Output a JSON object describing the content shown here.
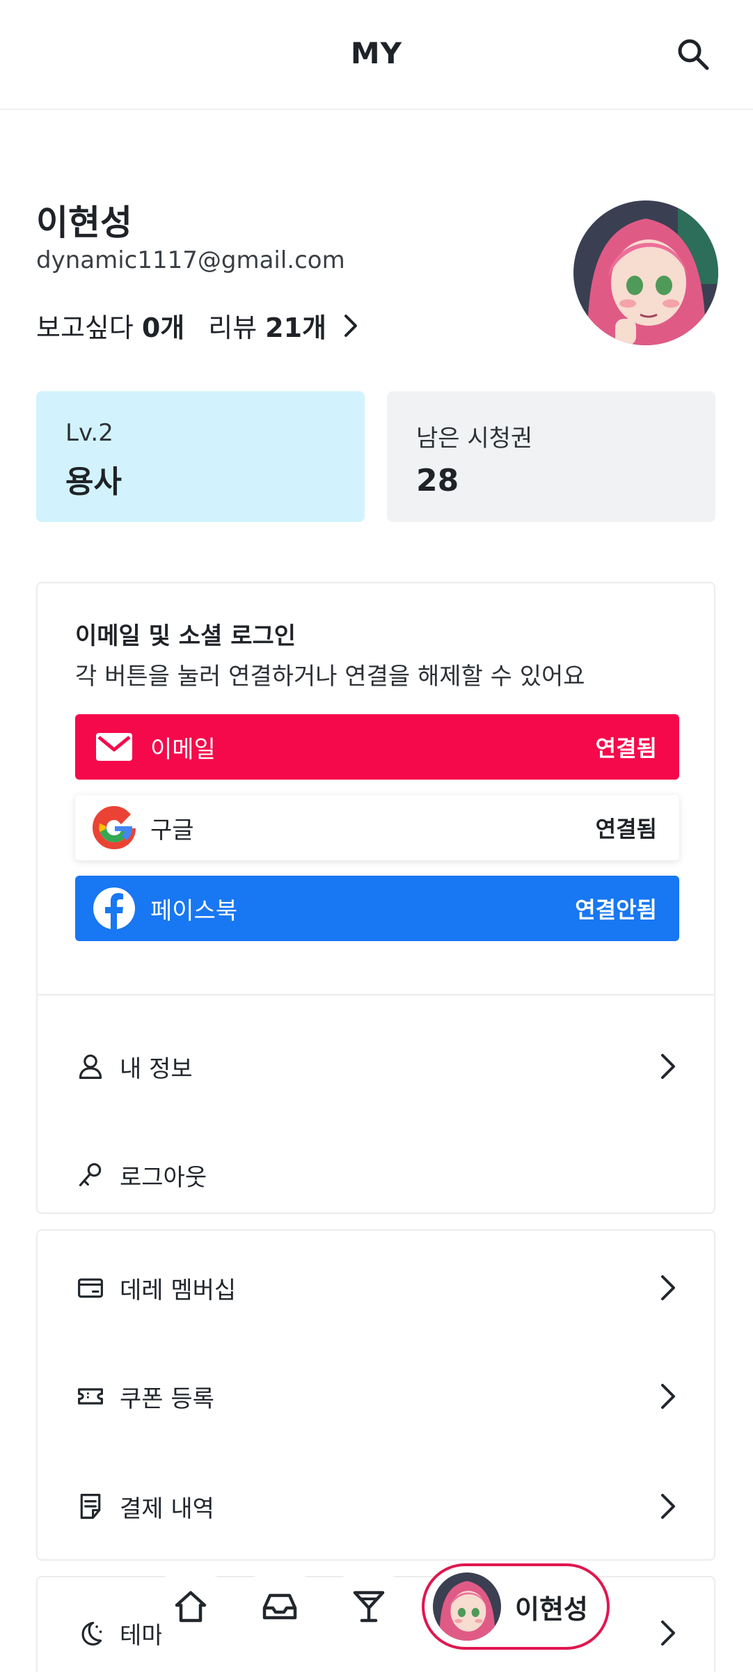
{
  "header": {
    "title": "MY"
  },
  "profile": {
    "name": "이현성",
    "email": "dynamic1117@gmail.com",
    "wishlist_label": "보고싶다",
    "wishlist_count": "0개",
    "review_label": "리뷰",
    "review_count": "21개"
  },
  "cards": {
    "level_label": "Lv.2",
    "level_value": "용사",
    "tickets_label": "남은 시청권",
    "tickets_value": "28"
  },
  "login": {
    "title": "이메일 및 소셜 로그인",
    "description": "각 버튼을 눌러 연결하거나 연결을 해제할 수 있어요",
    "buttons": [
      {
        "label": "이메일",
        "status": "연결됨",
        "icon": "mail-icon",
        "color": "#f5094b"
      },
      {
        "label": "구글",
        "status": "연결됨",
        "icon": "google-icon",
        "color": "#ffffff"
      },
      {
        "label": "페이스북",
        "status": "연결안됨",
        "icon": "facebook-icon",
        "color": "#1877f2"
      }
    ]
  },
  "account_menu": [
    {
      "label": "내 정보",
      "icon": "user-icon"
    },
    {
      "label": "로그아웃",
      "icon": "logout-icon"
    }
  ],
  "service_menu": [
    {
      "label": "데레 멤버십",
      "icon": "card-icon"
    },
    {
      "label": "쿠폰 등록",
      "icon": "ticket-icon"
    },
    {
      "label": "결제 내역",
      "icon": "receipt-icon"
    }
  ],
  "theme_menu": {
    "label": "테마",
    "icon": "moon-icon"
  },
  "bottom_nav": {
    "items": [
      "home-icon",
      "inbox-icon",
      "cocktail-icon"
    ],
    "profile_name": "이현성",
    "accent": "#e0174f"
  }
}
